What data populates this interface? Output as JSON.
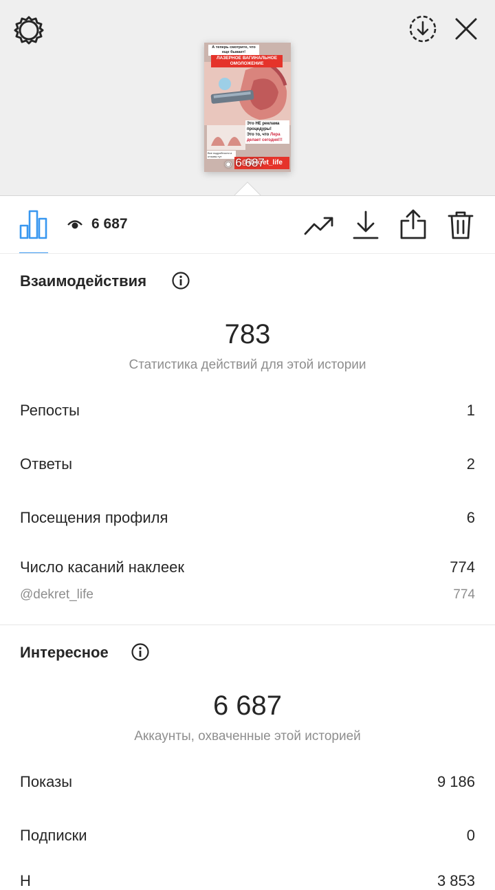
{
  "thumbnail": {
    "caption": "А теперь смотрите, что еще бывает!",
    "banner": "ЛАЗЕРНОЕ ВАГИНАЛЬНОЕ ОМОЛОЖЕНИЕ",
    "note_line1": "Это НЕ реклама процедуры!",
    "note_line2": "Это то, что",
    "note_name": "Лера",
    "note_line3": "делает сегодня!!!",
    "bottom_text": "Все подробности и отзывы тут",
    "tag": "@dekret_life",
    "overlay_views": "6 687"
  },
  "toolbar": {
    "views_count": "6 687",
    "icons": [
      "insights-bar-icon",
      "eye-icon",
      "trending-icon",
      "download-icon",
      "share-icon",
      "trash-icon"
    ]
  },
  "interactions": {
    "title": "Взаимодействия",
    "total": "783",
    "subtitle": "Статистика действий для этой истории",
    "rows": [
      {
        "label": "Репосты",
        "value": "1"
      },
      {
        "label": "Ответы",
        "value": "2"
      },
      {
        "label": "Посещения профиля",
        "value": "6"
      },
      {
        "label": "Число касаний наклеек",
        "value": "774"
      }
    ],
    "sticker": {
      "label": "@dekret_life",
      "value": "774"
    }
  },
  "discovery": {
    "title": "Интересное",
    "total": "6 687",
    "subtitle": "Аккаунты, охваченные этой историей",
    "rows": [
      {
        "label": "Показы",
        "value": "9 186"
      },
      {
        "label": "Подписки",
        "value": "0"
      },
      {
        "label": "Н",
        "value": "3 853"
      }
    ]
  },
  "colors": {
    "accent": "#3897f0",
    "text": "#262626",
    "secondary": "#8e8e8e",
    "header_bg": "#efefef"
  }
}
